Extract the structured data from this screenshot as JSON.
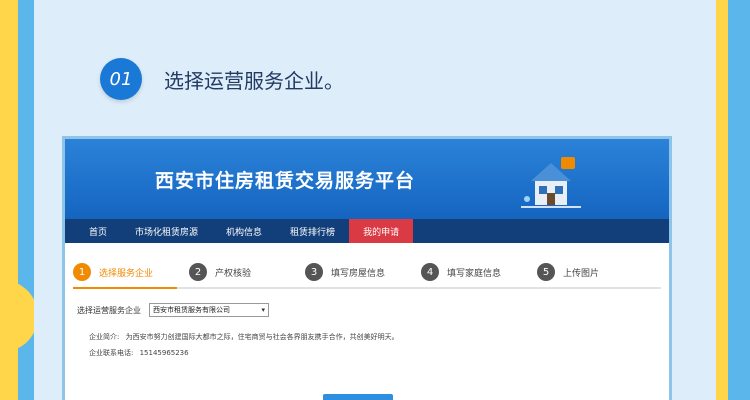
{
  "intro": {
    "step_number": "01",
    "step_text": "选择运营服务企业。"
  },
  "site": {
    "title": "西安市住房租赁交易服务平台",
    "nav": [
      {
        "label": "首页"
      },
      {
        "label": "市场化租赁房源"
      },
      {
        "label": "机构信息"
      },
      {
        "label": "租赁排行榜"
      },
      {
        "label": "我的申请"
      }
    ]
  },
  "steps": [
    {
      "num": "1",
      "label": "选择服务企业"
    },
    {
      "num": "2",
      "label": "产权核验"
    },
    {
      "num": "3",
      "label": "填写房屋信息"
    },
    {
      "num": "4",
      "label": "填写家庭信息"
    },
    {
      "num": "5",
      "label": "上传图片"
    }
  ],
  "form": {
    "label": "选择运营服务企业",
    "selected": "西安市租赁服务有限公司"
  },
  "company": {
    "intro_label": "企业简介:",
    "intro_text": "为西安市努力创建国际大都市之际，住宅商贸与社会各界朋友携手合作，共创美好明天。",
    "phone_label": "企业联系电话:",
    "phone": "15145965236"
  },
  "colors": {
    "background": "#5bb6ec",
    "accent_yellow": "#ffd54a",
    "banner_blue": "#1565c0",
    "nav_dark": "#123f7a",
    "nav_active": "#d93a43",
    "step_active": "#f08a00"
  }
}
